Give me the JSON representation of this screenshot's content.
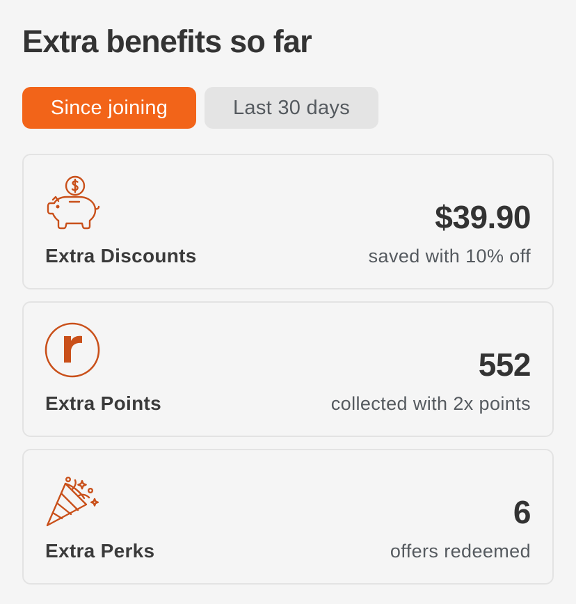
{
  "header": {
    "title": "Extra benefits so far"
  },
  "tabs": [
    {
      "label": "Since joining",
      "active": true
    },
    {
      "label": "Last 30 days",
      "active": false
    }
  ],
  "cards": [
    {
      "icon": "piggy-bank-icon",
      "label": "Extra Discounts",
      "value": "$39.90",
      "sub": "saved with 10% off"
    },
    {
      "icon": "points-r-icon",
      "label": "Extra Points",
      "value": "552",
      "sub": "collected with 2x points"
    },
    {
      "icon": "party-popper-icon",
      "label": "Extra Perks",
      "value": "6",
      "sub": "offers redeemed"
    }
  ],
  "colors": {
    "accent": "#f26419",
    "icon": "#c9501a",
    "text": "#333333",
    "muted": "#555a5f",
    "background": "#f5f5f5"
  }
}
